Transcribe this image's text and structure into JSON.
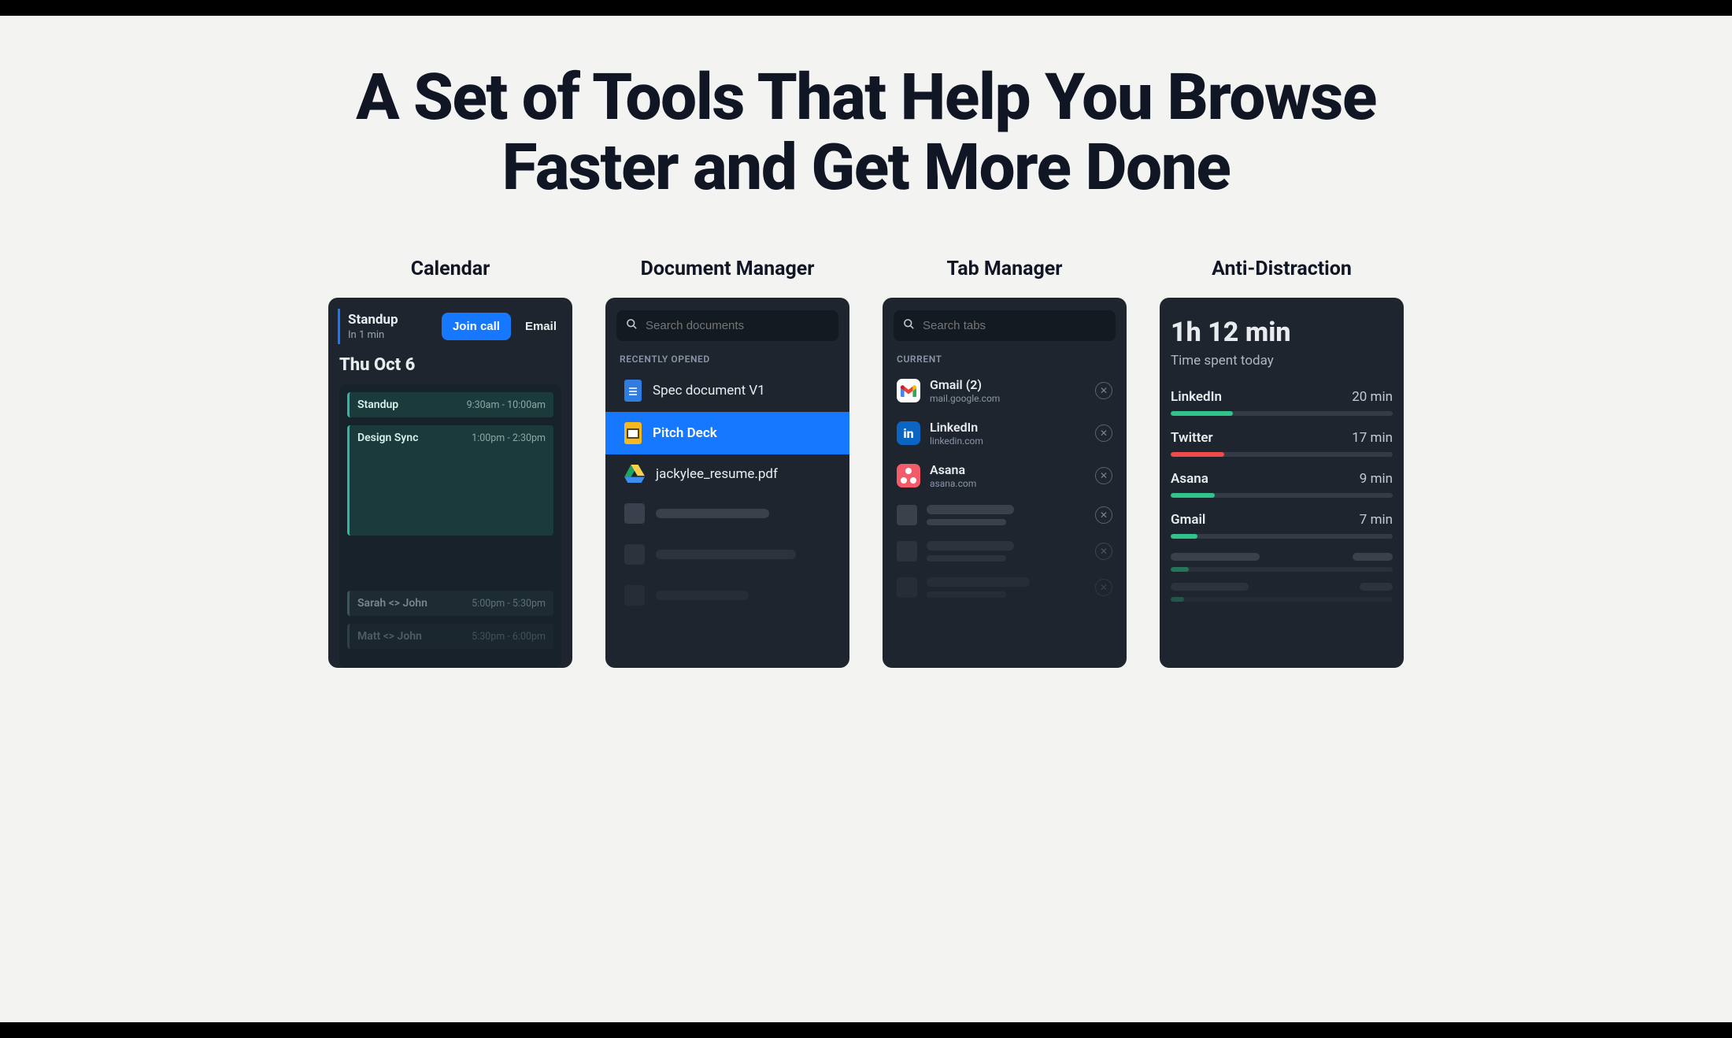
{
  "headline": "A Set of Tools That Help You Browse Faster and Get More Done",
  "columns": {
    "calendar": {
      "title": "Calendar",
      "next_event": {
        "name": "Standup",
        "countdown": "In 1 min"
      },
      "join_label": "Join call",
      "email_label": "Email",
      "date_label": "Thu Oct 6",
      "events": [
        {
          "name": "Standup",
          "time": "9:30am - 10:00am",
          "style": "green",
          "tall": false
        },
        {
          "name": "Design Sync",
          "time": "1:00pm - 2:30pm",
          "style": "green",
          "tall": true
        },
        {
          "name": "Sarah <> John",
          "time": "5:00pm - 5:30pm",
          "style": "faded",
          "tall": false
        },
        {
          "name": "Matt <> John",
          "time": "5:30pm - 6:00pm",
          "style": "faded2",
          "tall": false
        }
      ]
    },
    "documents": {
      "title": "Document Manager",
      "search_placeholder": "Search documents",
      "section_label": "RECENTLY OPENED",
      "items": [
        {
          "name": "Spec document V1",
          "icon": "gdoc",
          "selected": false
        },
        {
          "name": "Pitch Deck",
          "icon": "slides",
          "selected": true
        },
        {
          "name": "jackylee_resume.pdf",
          "icon": "drive",
          "selected": false
        }
      ]
    },
    "tabs": {
      "title": "Tab Manager",
      "search_placeholder": "Search tabs",
      "section_label": "CURRENT",
      "items": [
        {
          "name": "Gmail (2)",
          "url": "mail.google.com",
          "icon": "gmail"
        },
        {
          "name": "LinkedIn",
          "url": "linkedin.com",
          "icon": "linkedin"
        },
        {
          "name": "Asana",
          "url": "asana.com",
          "icon": "asana"
        }
      ]
    },
    "anti": {
      "title": "Anti-Distraction",
      "total": "1h 12 min",
      "subtitle": "Time spent today",
      "items": [
        {
          "app": "LinkedIn",
          "time": "20 min",
          "pct": 28,
          "color": "green"
        },
        {
          "app": "Twitter",
          "time": "17 min",
          "pct": 24,
          "color": "red"
        },
        {
          "app": "Asana",
          "time": "9 min",
          "pct": 13,
          "color": "green"
        },
        {
          "app": "Gmail",
          "time": "7 min",
          "pct": 10,
          "color": "green"
        }
      ]
    }
  }
}
